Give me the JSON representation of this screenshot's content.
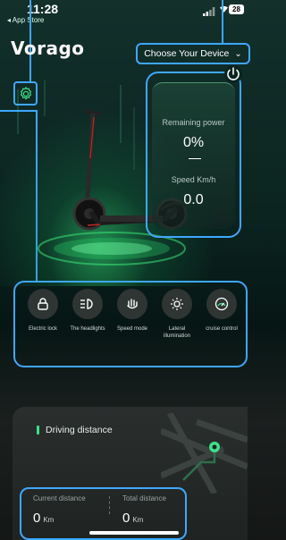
{
  "status_bar": {
    "time": "11:28",
    "back_app": "◂ App Store",
    "battery": "28"
  },
  "header": {
    "logo": "Vorago",
    "device_selector_label": "Choose Your Device"
  },
  "power_panel": {
    "remaining_power_label": "Remaining power",
    "remaining_power_value": "0%",
    "speed_label": "Speed Km/h",
    "speed_value": "0.0"
  },
  "features": [
    {
      "label": "Electric lock",
      "icon": "lock-icon"
    },
    {
      "label": "The headlights",
      "icon": "headlight-icon"
    },
    {
      "label": "Speed mode",
      "icon": "hand-speed-icon"
    },
    {
      "label": "Lateral illumination",
      "icon": "sun-light-icon"
    },
    {
      "label": "cruise control",
      "icon": "speedometer-icon"
    }
  ],
  "driving": {
    "title": "Driving distance",
    "current_label": "Current distance",
    "current_value": "0",
    "total_label": "Total distance",
    "total_value": "0",
    "unit": "Km"
  },
  "colors": {
    "accent_annotation": "#3fa7ff",
    "accent_green": "#3de08a",
    "background": "#0b2420"
  }
}
